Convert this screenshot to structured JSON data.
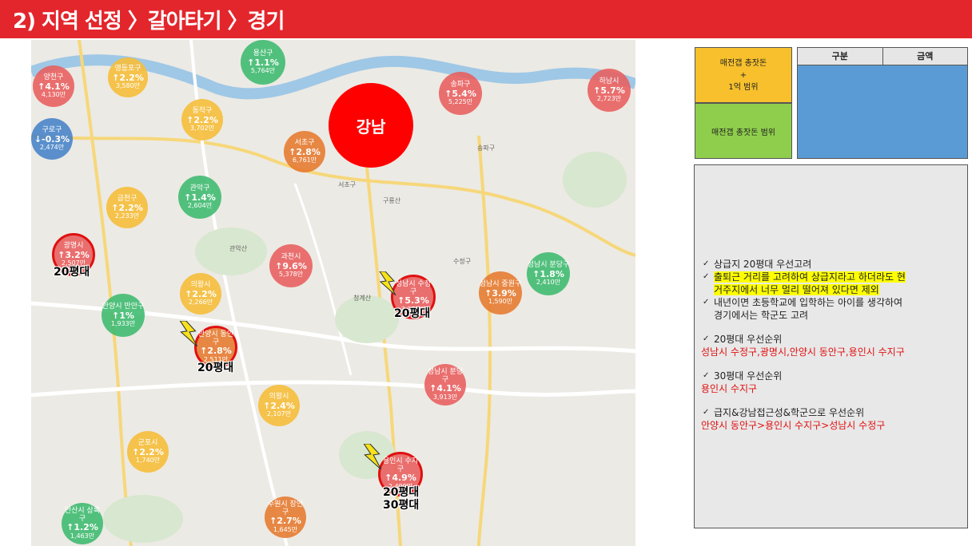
{
  "title": "2) 지역 선정 〉갈아타기 〉경기",
  "hub": {
    "label": "강남"
  },
  "districts": [
    {
      "id": "yangcheon",
      "name": "양천구",
      "pct": "↑4.1%",
      "amt": "4,130만",
      "color": "red"
    },
    {
      "id": "yeongdeungpo",
      "name": "영등포구",
      "pct": "↑2.2%",
      "amt": "3,580만",
      "color": "yellow"
    },
    {
      "id": "yongsan",
      "name": "용산구",
      "pct": "↑1.1%",
      "amt": "5,764만",
      "color": "green"
    },
    {
      "id": "songpa",
      "name": "송파구",
      "pct": "↑5.4%",
      "amt": "5,225만",
      "color": "red"
    },
    {
      "id": "hanam",
      "name": "하남시",
      "pct": "↑5.7%",
      "amt": "2,723만",
      "color": "red"
    },
    {
      "id": "guro",
      "name": "구로구",
      "pct": "↓-0.3%",
      "amt": "2,474만",
      "color": "blue"
    },
    {
      "id": "dongjak",
      "name": "동작구",
      "pct": "↑2.2%",
      "amt": "3,702만",
      "color": "yellow"
    },
    {
      "id": "seocho",
      "name": "서초구",
      "pct": "↑2.8%",
      "amt": "6,761만",
      "color": "orange"
    },
    {
      "id": "geumcheon",
      "name": "금천구",
      "pct": "↑2.2%",
      "amt": "2,233만",
      "color": "yellow"
    },
    {
      "id": "gwanak",
      "name": "관악구",
      "pct": "↑1.4%",
      "amt": "2,604만",
      "color": "green"
    },
    {
      "id": "gwangmyeong",
      "name": "광명시",
      "pct": "↑3.2%",
      "amt": "2,507만",
      "color": "red",
      "highlight": true
    },
    {
      "id": "gwacheon",
      "name": "과천시",
      "pct": "↑9.6%",
      "amt": "5,378만",
      "color": "red"
    },
    {
      "id": "sujeong",
      "name": "성남시 수정구",
      "pct": "↑5.3%",
      "amt": "3,251만",
      "color": "red",
      "highlight": true
    },
    {
      "id": "jungwon",
      "name": "성남시 중원구",
      "pct": "↑3.9%",
      "amt": "1,590만",
      "color": "orange"
    },
    {
      "id": "bundang-top",
      "name": "성남시 분당구",
      "pct": "↑1.8%",
      "amt": "2,410만",
      "color": "green"
    },
    {
      "id": "uiwang",
      "name": "의왕시",
      "pct": "↑2.2%",
      "amt": "2,266만",
      "color": "yellow"
    },
    {
      "id": "manan",
      "name": "안양시 만안구",
      "pct": "↑1%",
      "amt": "1,933만",
      "color": "green"
    },
    {
      "id": "dongan",
      "name": "안양시 동안구",
      "pct": "↑2.8%",
      "amt": "2,511만",
      "color": "orange",
      "highlight": true
    },
    {
      "id": "bundang",
      "name": "성남시 분당구",
      "pct": "↑4.1%",
      "amt": "3,913만",
      "color": "red"
    },
    {
      "id": "uiwang2",
      "name": "의왕시",
      "pct": "↑2.4%",
      "amt": "2,107만",
      "color": "yellow"
    },
    {
      "id": "gunpo",
      "name": "군포시",
      "pct": "↑2.2%",
      "amt": "1,740만",
      "color": "yellow"
    },
    {
      "id": "suji",
      "name": "용인시 수지구",
      "pct": "↑4.9%",
      "amt": "2,499만",
      "color": "red",
      "highlight": true
    },
    {
      "id": "sangnok",
      "name": "안산시 상록구",
      "pct": "↑1.2%",
      "amt": "1,463만",
      "color": "green"
    },
    {
      "id": "jangan",
      "name": "수원시 장안구",
      "pct": "↑2.7%",
      "amt": "1,645만",
      "color": "orange"
    }
  ],
  "size_labels": {
    "gwangmyeong": "20평대",
    "sujeong": "20평대",
    "dongan": "20평대",
    "suji_1": "20평대",
    "suji_2": "30평대"
  },
  "map_labels": {
    "seocho_gu": "서초구",
    "suseo": "수정구",
    "gwanaksan": "관악산",
    "cheonggyesan": "청계산",
    "songpa_gu": "송파구",
    "guryong": "구룡산"
  },
  "legend": {
    "yellow_line1": "매전갭 총잣돈",
    "yellow_line2": "+",
    "yellow_line3": "1억 범위",
    "green": "매전갭 총잣돈 범위"
  },
  "table": {
    "col1": "구분",
    "col2": "금액"
  },
  "notes": {
    "item1": "상급지 20평대 우선고려",
    "item2_line1": "출퇴근 거리를 고려하여 상급지라고 하더라도 현",
    "item2_line2": "거주지에서 너무 멀리 떨어져 있다면 제외",
    "item3_line1": "내년이면 초등학교에 입학하는 아이를 생각하여",
    "item3_line2": "경기에서는 학군도 고려",
    "item4": "20평대 우선순위",
    "item4_red": "성남시 수정구,광명시,안양시  동안구,용인시 수지구",
    "item5": "30평대 우선순위",
    "item5_red": "용인시 수지구",
    "item6": "급지&강남접근성&학군으로  우선순위",
    "item6_red": "안양시 동안구>용인시 수지구>성남시 수정구"
  },
  "colors": {
    "title_bar": "#e3262c",
    "hub": "#ff0000",
    "highlight_ring": "#e01010",
    "table_fill": "#5b9bd5"
  }
}
